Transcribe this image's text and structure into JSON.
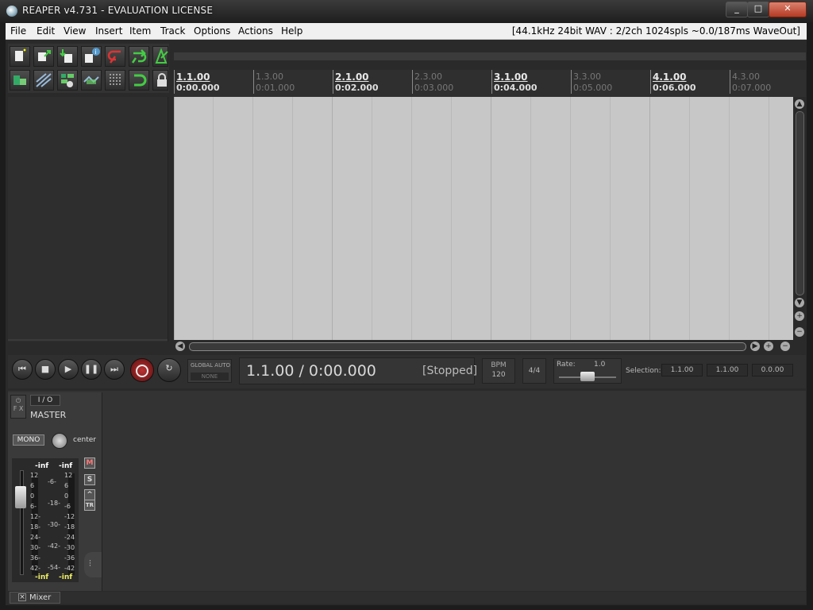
{
  "window": {
    "title": "REAPER v4.731 - EVALUATION LICENSE",
    "min_icon": "minimize-icon",
    "max_icon": "maximize-icon",
    "close_glyph": "✕"
  },
  "menu": {
    "items": [
      "File",
      "Edit",
      "View",
      "Insert",
      "Item",
      "Track",
      "Options",
      "Actions",
      "Help"
    ],
    "status": "[44.1kHz 24bit WAV : 2/2ch 1024spls ~0.0/187ms WaveOut]"
  },
  "toolbar": {
    "icons": [
      "new-project-icon",
      "open-project-icon",
      "save-project-icon",
      "project-settings-icon",
      "undo-icon",
      "redo-icon",
      "metronome-icon",
      "grid-toggle-icon",
      "ripple-edit-icon",
      "item-grouping-icon",
      "envelope-points-icon",
      "snap-icon",
      "loop-icon",
      "lock-icon"
    ]
  },
  "ruler": {
    "marks": [
      {
        "bar": "1.1.00",
        "time": "0:00.000",
        "major": true
      },
      {
        "bar": "1.3.00",
        "time": "0:01.000",
        "major": false
      },
      {
        "bar": "2.1.00",
        "time": "0:02.000",
        "major": true
      },
      {
        "bar": "2.3.00",
        "time": "0:03.000",
        "major": false
      },
      {
        "bar": "3.1.00",
        "time": "0:04.000",
        "major": true
      },
      {
        "bar": "3.3.00",
        "time": "0:05.000",
        "major": false
      },
      {
        "bar": "4.1.00",
        "time": "0:06.000",
        "major": true
      },
      {
        "bar": "4.3.00",
        "time": "0:07.000",
        "major": false
      }
    ]
  },
  "transport": {
    "buttons": [
      "⏮",
      "■",
      "▶",
      "❚❚",
      "⏭"
    ],
    "position": "1.1.00 / 0:00.000",
    "state": "[Stopped]",
    "global_auto_label": "GLOBAL AUTO",
    "global_auto_value": "NONE",
    "bpm_label": "BPM",
    "bpm_value": "120",
    "time_signature": "4/4",
    "rate_label": "Rate:",
    "rate_value": "1.0",
    "rate_level": 0.5,
    "selection_label": "Selection:",
    "selection_start": "1.1.00",
    "selection_end": "1.1.00",
    "selection_length": "0.0.00"
  },
  "master": {
    "fx_label": "F X",
    "io_label": "I / O",
    "name": "MASTER",
    "mono_label": "MONO",
    "pan_label": "center",
    "peak_left": "-inf",
    "peak_right": "-inf",
    "bottom_left": "-inf",
    "bottom_right": "-inf",
    "scale_left": [
      "12",
      "6",
      "0",
      "6-",
      "12-",
      "18-",
      "24-",
      "30-",
      "36-",
      "42-"
    ],
    "scale_mid": [
      "-6-",
      "-18-",
      "-30-",
      "-42-",
      "-54-"
    ],
    "scale_right": [
      "12",
      "6",
      "0",
      "-6",
      "-12",
      "-18",
      "-24",
      "-30",
      "-36",
      "-42"
    ],
    "mute_label": "M",
    "solo_label": "S",
    "trim_label": "TR",
    "fader_level": 0.85
  },
  "bottom_tab": {
    "label": "Mixer"
  },
  "colors": {
    "arrange_bg": "#c7c7c7",
    "panel_bg": "#2a2a2a",
    "menu_bg": "#f0f0f0"
  }
}
